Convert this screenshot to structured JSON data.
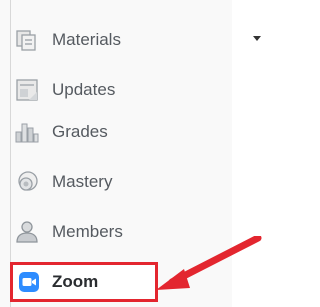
{
  "nav": {
    "items": [
      {
        "label": "Materials",
        "icon": "materials-icon"
      },
      {
        "label": "Updates",
        "icon": "updates-icon"
      },
      {
        "label": "Grades",
        "icon": "grades-icon"
      },
      {
        "label": "Mastery",
        "icon": "mastery-icon"
      },
      {
        "label": "Members",
        "icon": "members-icon"
      },
      {
        "label": "Zoom",
        "icon": "zoom-icon"
      }
    ]
  },
  "colors": {
    "highlight": "#e3262f",
    "zoom_brand": "#2d8cff",
    "text": "#555a60"
  }
}
